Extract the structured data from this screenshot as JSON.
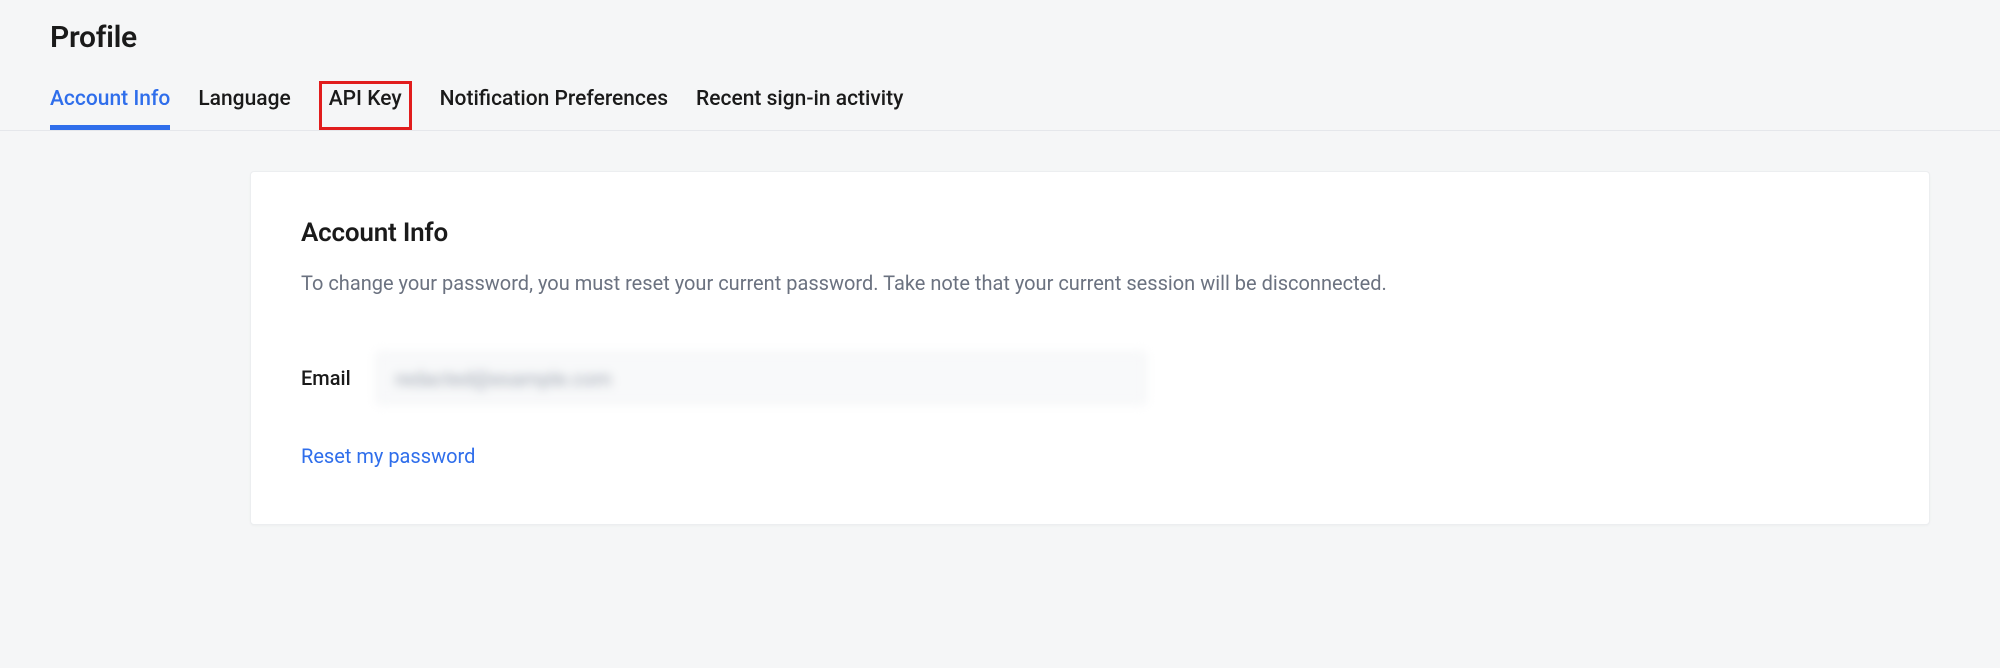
{
  "header": {
    "title": "Profile"
  },
  "tabs": {
    "items": [
      {
        "label": "Account Info",
        "active": true,
        "highlighted": false
      },
      {
        "label": "Language",
        "active": false,
        "highlighted": false
      },
      {
        "label": "API Key",
        "active": false,
        "highlighted": true
      },
      {
        "label": "Notification Preferences",
        "active": false,
        "highlighted": false
      },
      {
        "label": "Recent sign-in activity",
        "active": false,
        "highlighted": false
      }
    ]
  },
  "card": {
    "title": "Account Info",
    "description": "To change your password, you must reset your current password. Take note that your current session will be disconnected.",
    "email_label": "Email",
    "email_value": "redacted@example.com",
    "reset_link": "Reset my password"
  }
}
